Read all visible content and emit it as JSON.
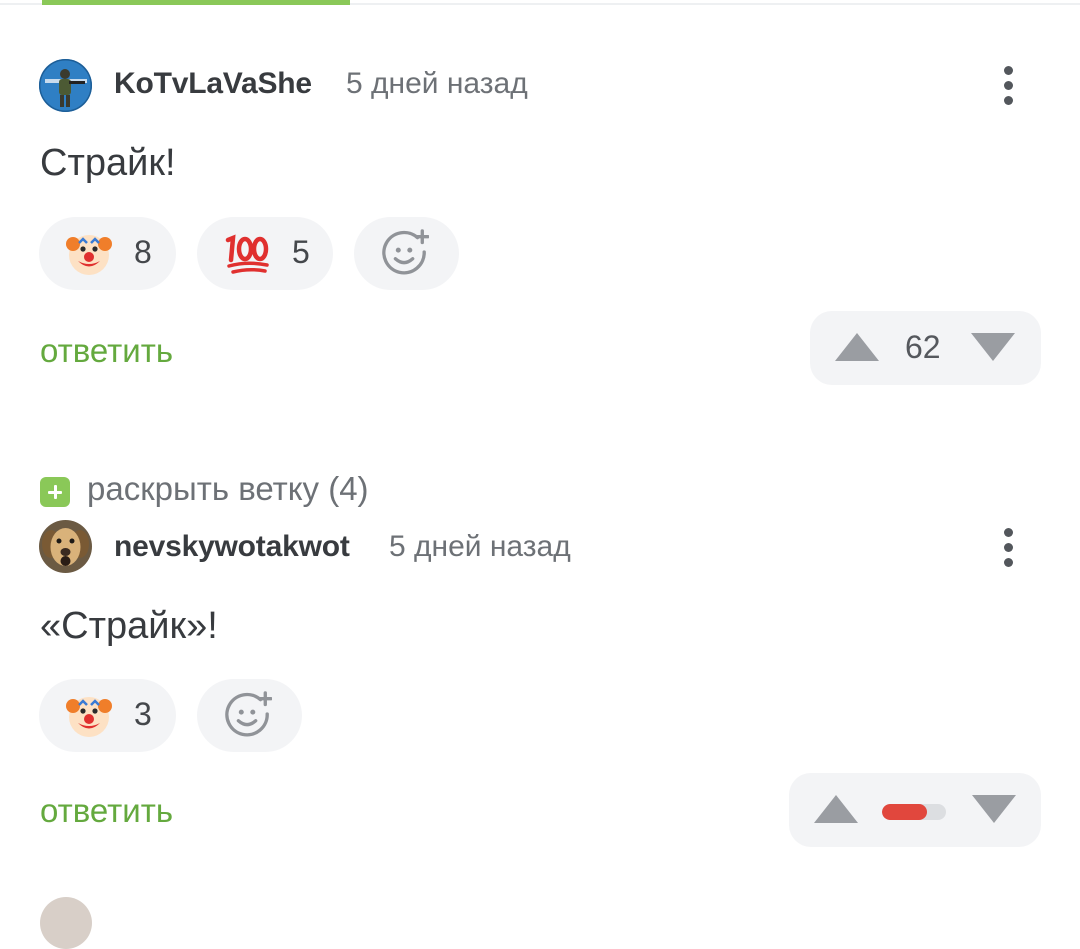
{
  "comments": [
    {
      "author": "KoTvLaVaShe",
      "time": "5 дней назад",
      "text": "Страйк!",
      "avatar": "soldier-avatar",
      "reactions": [
        {
          "emoji": "clown-face",
          "count": "8"
        },
        {
          "emoji": "hundred-points",
          "count": "5"
        }
      ],
      "add_reaction_icon": "smiley-plus-icon",
      "reply_label": "ответить",
      "score": "62"
    },
    {
      "author": "nevskywotakwot",
      "time": "5 дней назад",
      "text": "«Страйк»!",
      "avatar": "dog-avatar",
      "reactions": [
        {
          "emoji": "clown-face",
          "count": "3"
        }
      ],
      "add_reaction_icon": "smiley-plus-icon",
      "reply_label": "ответить",
      "rating_positive_fraction": 0.7
    }
  ],
  "expand_thread": {
    "label": "раскрыть ветку (4)"
  },
  "colors": {
    "accent_green": "#64a93e",
    "tab_green": "#8ac858",
    "pill_bg": "#f3f4f6",
    "downvote_red": "#e1473d",
    "icon_gray": "#9a9da2"
  }
}
